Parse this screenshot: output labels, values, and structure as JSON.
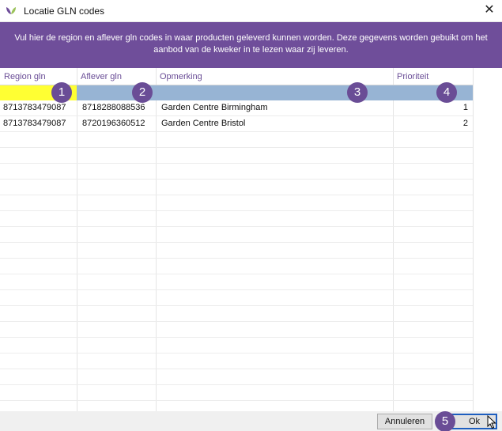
{
  "window": {
    "title": "Locatie GLN codes",
    "close_glyph": "✕"
  },
  "banner": {
    "text": "Vul hier de region en aflever gln codes in waar producten geleverd kunnen worden. Deze gegevens worden gebuikt om het aanbod van de kweker in te lezen waar zij leveren."
  },
  "grid": {
    "columns": [
      "Region gln",
      "Aflever gln",
      "Opmerking",
      "Prioriteit"
    ],
    "rows": [
      {
        "region": "8713783479087",
        "aflever": "8718288088536",
        "opmerking": "Garden Centre Birmingham",
        "prioriteit": "1"
      },
      {
        "region": "8713783479087",
        "aflever": "8720196360512",
        "opmerking": "Garden Centre Bristol",
        "prioriteit": "2"
      }
    ]
  },
  "badges": [
    "1",
    "2",
    "3",
    "4",
    "5"
  ],
  "footer": {
    "cancel_label": "Annuleren",
    "ok_label": "Ok"
  },
  "colors": {
    "accent": "#6f4e9a",
    "filter_row": "#97b4d4",
    "active_filter": "#ffff33"
  },
  "icons": {
    "app": "leaf-icon",
    "close": "close-icon",
    "cursor": "mouse-pointer-icon"
  }
}
